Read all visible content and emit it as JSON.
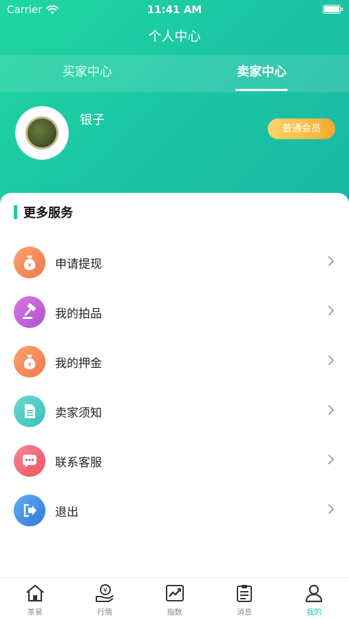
{
  "status_bar": {
    "carrier": "Carrier",
    "time": "11:41 AM"
  },
  "nav": {
    "title": "个人中心"
  },
  "tabs": [
    {
      "label": "买家中心",
      "active": false
    },
    {
      "label": "卖家中心",
      "active": true
    }
  ],
  "profile": {
    "username": "银子",
    "member_level": "普通会员"
  },
  "services": {
    "title": "更多服务",
    "items": [
      {
        "label": "申请提现",
        "icon": "money-bag-icon",
        "color": "#f7885a"
      },
      {
        "label": "我的拍品",
        "icon": "auction-gavel-icon",
        "color": "#c25ad8"
      },
      {
        "label": "我的押金",
        "icon": "money-bag-icon",
        "color": "#f7885a"
      },
      {
        "label": "卖家须知",
        "icon": "document-icon",
        "color": "#43c9c2"
      },
      {
        "label": "联系客服",
        "icon": "chat-bubble-icon",
        "color": "#f0606f"
      },
      {
        "label": "退出",
        "icon": "logout-icon",
        "color": "#3b87e6"
      }
    ]
  },
  "bottom_nav": [
    {
      "label": "茶易",
      "icon": "home-icon",
      "active": false
    },
    {
      "label": "行情",
      "icon": "price-hand-icon",
      "active": false
    },
    {
      "label": "指数",
      "icon": "index-chart-icon",
      "active": false
    },
    {
      "label": "消息",
      "icon": "clipboard-message-icon",
      "active": false
    },
    {
      "label": "我的",
      "icon": "user-profile-icon",
      "active": true
    }
  ],
  "colors": {
    "accent": "#1fc6a6",
    "header_gradient_start": "#1fd6a0",
    "header_gradient_end": "#19b7a5",
    "badge_gradient_start": "#ffd569",
    "badge_gradient_end": "#f7a92f"
  }
}
